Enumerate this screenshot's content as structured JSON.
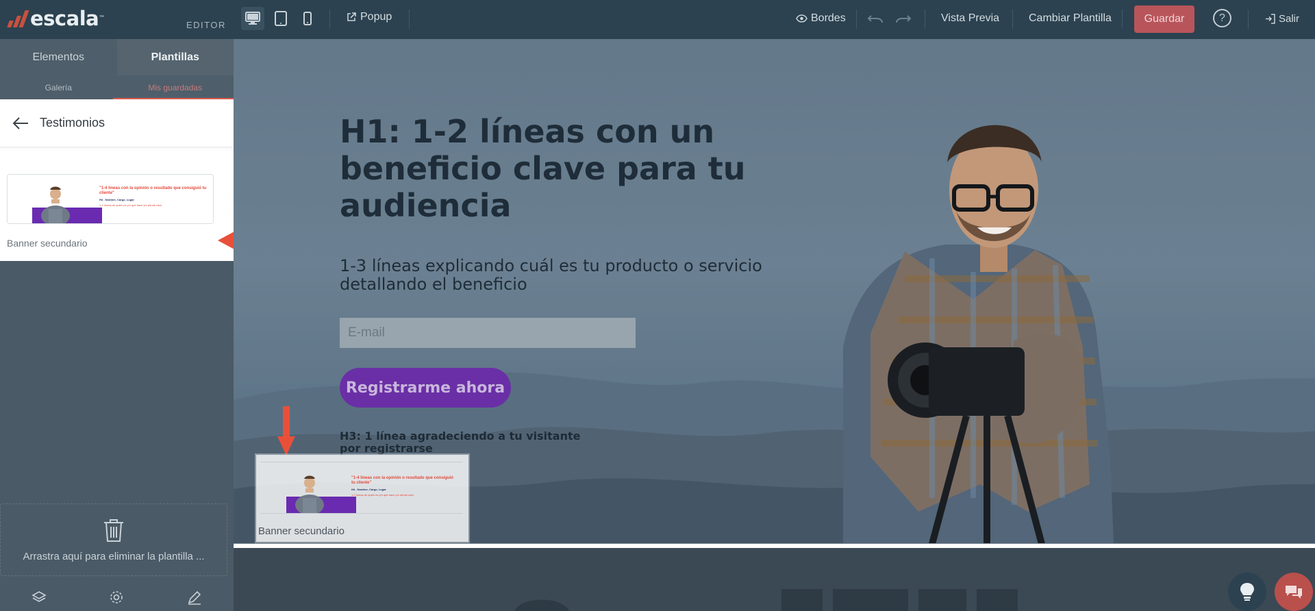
{
  "topbar": {
    "logo_text": "escala",
    "logo_tm": "™",
    "editor_label": "EDITOR",
    "popup_label": "Popup",
    "bordes_label": "Bordes",
    "preview_label": "Vista Previa",
    "change_template_label": "Cambiar Plantilla",
    "save_label": "Guardar",
    "help_label": "?",
    "exit_label": "Salir"
  },
  "sidebar": {
    "tabs": [
      {
        "label": "Elementos",
        "active": false
      },
      {
        "label": "Plantillas",
        "active": true
      }
    ],
    "subtabs": [
      {
        "label": "Galería",
        "active": false
      },
      {
        "label": "Mis guardadas",
        "active": true
      }
    ],
    "panel_title": "Testimonios",
    "template_name": "Banner secundario",
    "template_thumb": {
      "quote": "\"1-4 líneas con la opinión o resultado que consiguió tu cliente\"",
      "author": "H4 - Nombre, Cargo, Lugar",
      "detail": "1-2 líneas de quién es y/o qué hace y/o dónde está"
    },
    "trash_text": "Arrastra aquí para eliminar la plantilla ..."
  },
  "canvas": {
    "h1": "H1: 1-2 líneas con un beneficio clave para tu audiencia",
    "subtitle": "1-3 líneas explicando cuál es tu producto o servicio detallando el beneficio",
    "email_placeholder": "E-mail",
    "cta_label": "Registrarme ahora",
    "h3": "H3: 1 línea agradeciendo a tu visitante por registrarse",
    "drag_ghost_label": "Banner secundario"
  },
  "colors": {
    "topbar_bg": "#2c4250",
    "save_button": "#b8555a",
    "cta_purple": "#6a2fa6",
    "accent_red": "#e05b4b"
  }
}
